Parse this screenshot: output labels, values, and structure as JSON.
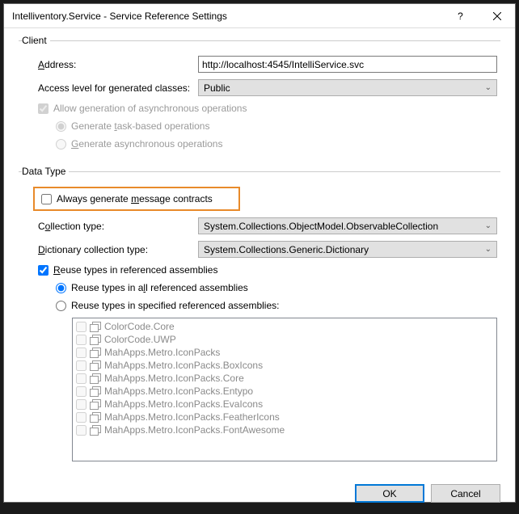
{
  "title": "Intelliventory.Service - Service Reference Settings",
  "client": {
    "legend": "Client",
    "address_label": "Address:",
    "address_value": "http://localhost:4545/IntelliService.svc",
    "access_label": "Access level for generated classes:",
    "access_value": "Public",
    "allow_async": "Allow generation of asynchronous operations",
    "gen_task": "Generate task-based operations",
    "gen_async": "Generate asynchronous operations"
  },
  "datatype": {
    "legend": "Data Type",
    "always_msg": "Always generate message contracts",
    "collection_label": "Collection type:",
    "collection_value": "System.Collections.ObjectModel.ObservableCollection",
    "dict_label": "Dictionary collection type:",
    "dict_value": "System.Collections.Generic.Dictionary",
    "reuse": "Reuse types in referenced assemblies",
    "reuse_all": "Reuse types in all referenced assemblies",
    "reuse_spec": "Reuse types in specified referenced assemblies:",
    "assemblies": [
      "ColorCode.Core",
      "ColorCode.UWP",
      "MahApps.Metro.IconPacks",
      "MahApps.Metro.IconPacks.BoxIcons",
      "MahApps.Metro.IconPacks.Core",
      "MahApps.Metro.IconPacks.Entypo",
      "MahApps.Metro.IconPacks.EvaIcons",
      "MahApps.Metro.IconPacks.FeatherIcons",
      "MahApps.Metro.IconPacks.FontAwesome"
    ]
  },
  "buttons": {
    "ok": "OK",
    "cancel": "Cancel"
  }
}
